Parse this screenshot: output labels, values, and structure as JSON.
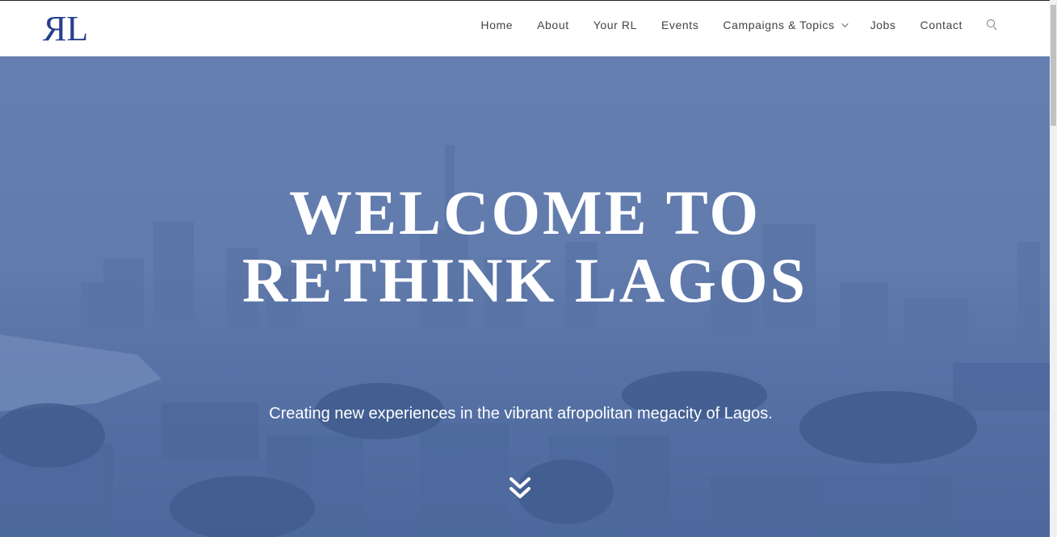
{
  "header": {
    "logo_left": "R",
    "logo_right": "L",
    "nav": [
      {
        "label": "Home"
      },
      {
        "label": "About"
      },
      {
        "label": "Your RL"
      },
      {
        "label": "Events"
      },
      {
        "label": "Campaigns & Topics",
        "has_dropdown": true
      },
      {
        "label": "Jobs"
      },
      {
        "label": "Contact"
      }
    ],
    "search_icon": "search-icon"
  },
  "hero": {
    "title_line1": "WELCOME TO",
    "title_line2": "RETHINK LAGOS",
    "subtitle": "Creating new experiences in the vibrant afropolitan megacity of Lagos.",
    "scroll_icon": "double-chevron-down-icon"
  },
  "colors": {
    "brand": "#26408e",
    "hero_tint": "#6982b1",
    "nav_text": "#444444"
  }
}
